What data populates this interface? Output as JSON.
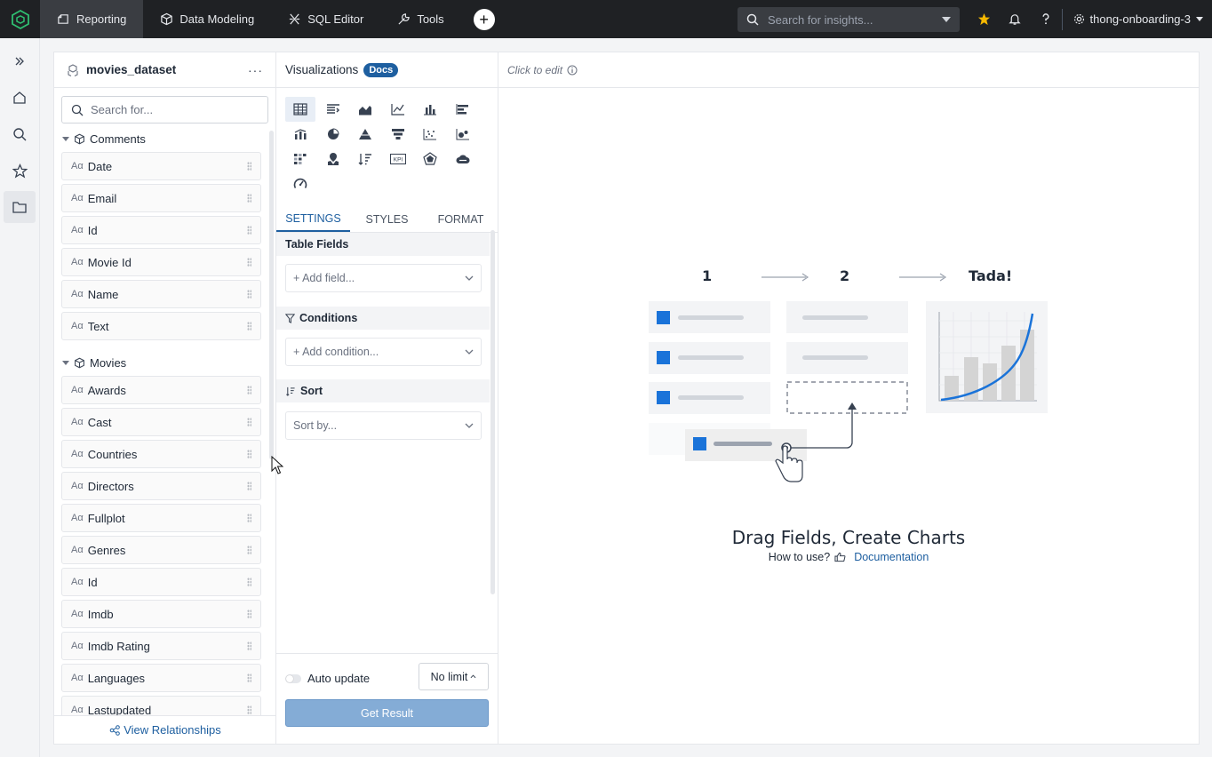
{
  "nav": {
    "tabs": [
      {
        "label": "Reporting",
        "icon": "reporting-icon",
        "active": true
      },
      {
        "label": "Data Modeling",
        "icon": "cube-icon"
      },
      {
        "label": "SQL Editor",
        "icon": "sql-icon"
      },
      {
        "label": "Tools",
        "icon": "wrench-icon"
      }
    ],
    "search_placeholder": "Search for insights...",
    "workspace": "thong-onboarding-3",
    "colors": {
      "bg": "#1f2124",
      "star": "#f5b800",
      "accent": "#1e5fa0"
    }
  },
  "dataset": {
    "name": "movies_dataset",
    "search_placeholder": "Search for...",
    "groups": [
      {
        "name": "Comments",
        "fields": [
          "Date",
          "Email",
          "Id",
          "Movie Id",
          "Name",
          "Text"
        ]
      },
      {
        "name": "Movies",
        "fields": [
          "Awards",
          "Cast",
          "Countries",
          "Directors",
          "Fullplot",
          "Genres",
          "Id",
          "Imdb",
          "Imdb Rating",
          "Languages",
          "Lastupdated"
        ]
      }
    ],
    "field_type_glyph": "Aα",
    "footer_link": "View Relationships"
  },
  "viz": {
    "title": "Visualizations",
    "docs_badge": "Docs",
    "tabs": [
      "SETTINGS",
      "STYLES",
      "FORMAT"
    ],
    "sections": {
      "table_fields": "Table Fields",
      "add_field": "+ Add field...",
      "conditions": "Conditions",
      "add_condition": "+ Add condition...",
      "sort": "Sort",
      "sort_by": "Sort by..."
    },
    "auto_update": "Auto update",
    "limit": "No limit",
    "get_result": "Get Result",
    "kpi_label": "KPI"
  },
  "canvas": {
    "click_to_edit": "Click to edit",
    "steps": [
      "1",
      "2",
      "Tada!"
    ],
    "title": "Drag Fields, Create Charts",
    "how_to": "How to use?",
    "doc_link": "Documentation"
  }
}
